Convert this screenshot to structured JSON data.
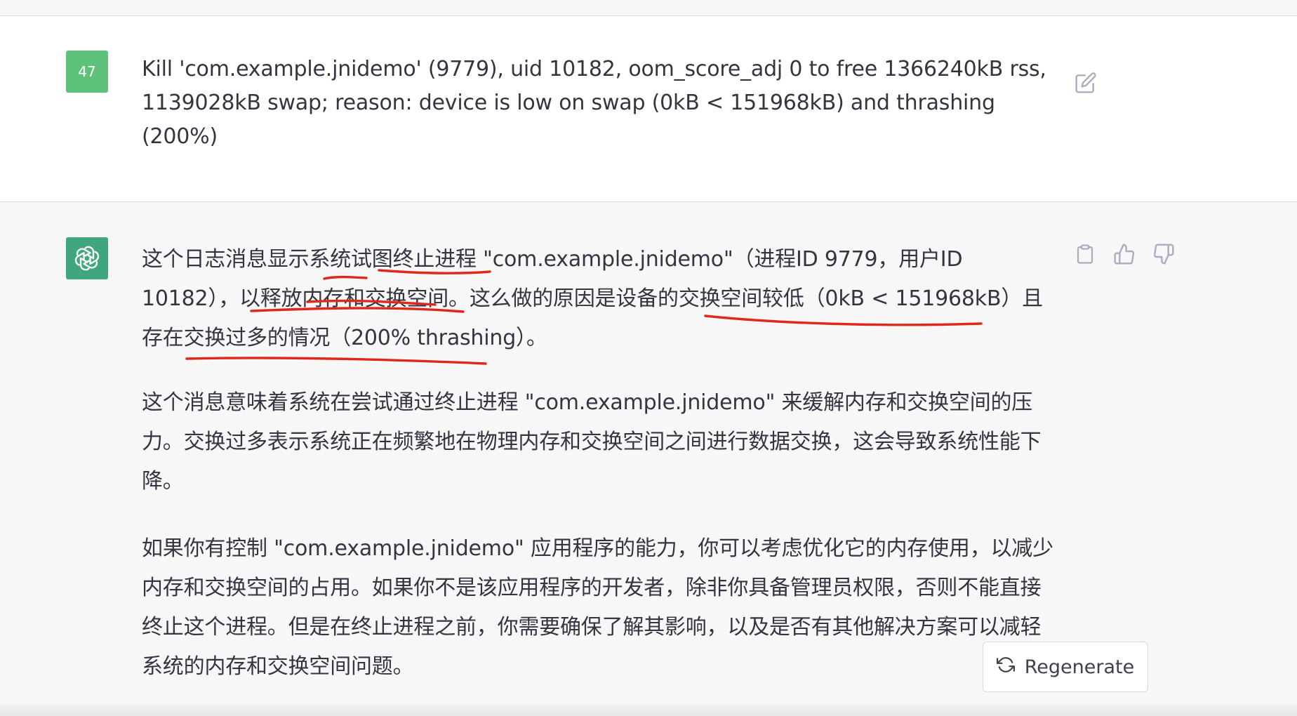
{
  "user_message": {
    "avatar_label": "47",
    "text": "Kill 'com.example.jnidemo' (9779), uid 10182, oom_score_adj 0 to free 1366240kB rss, 1139028kB swap; reason: device is low on swap (0kB < 151968kB) and thrashing (200%)",
    "edit_icon": "edit-icon"
  },
  "assistant_message": {
    "avatar_icon": "openai-logo-icon",
    "paragraphs": [
      "这个日志消息显示系统试图终止进程 \"com.example.jnidemo\"（进程ID 9779，用户ID 10182），以释放内存和交换空间。这么做的原因是设备的交换空间较低（0kB < 151968kB）且存在交换过多的情况（200% thrashing）。",
      "这个消息意味着系统在尝试通过终止进程 \"com.example.jnidemo\" 来缓解内存和交换空间的压力。交换过多表示系统正在频繁地在物理内存和交换空间之间进行数据交换，这会导致系统性能下降。",
      "如果你有控制 \"com.example.jnidemo\" 应用程序的能力，你可以考虑优化它的内存使用，以减少内存和交换空间的占用。如果你不是该应用程序的开发者，除非你具备管理员权限，否则不能直接终止这个进程。但是在终止进程之前，你需要确保了解其影响，以及是否有其他解决方案可以减轻系统的内存和交换空间问题。"
    ],
    "action_icons": [
      "clipboard-icon",
      "thumbs-up-icon",
      "thumbs-down-icon"
    ]
  },
  "regenerate_button": {
    "label": "Regenerate",
    "icon": "refresh-icon"
  },
  "colors": {
    "user_avatar": "#5ec27a",
    "assistant_avatar": "#3fa67e",
    "annotation_red": "#e0281a",
    "assistant_bg": "#f7f7f8"
  }
}
